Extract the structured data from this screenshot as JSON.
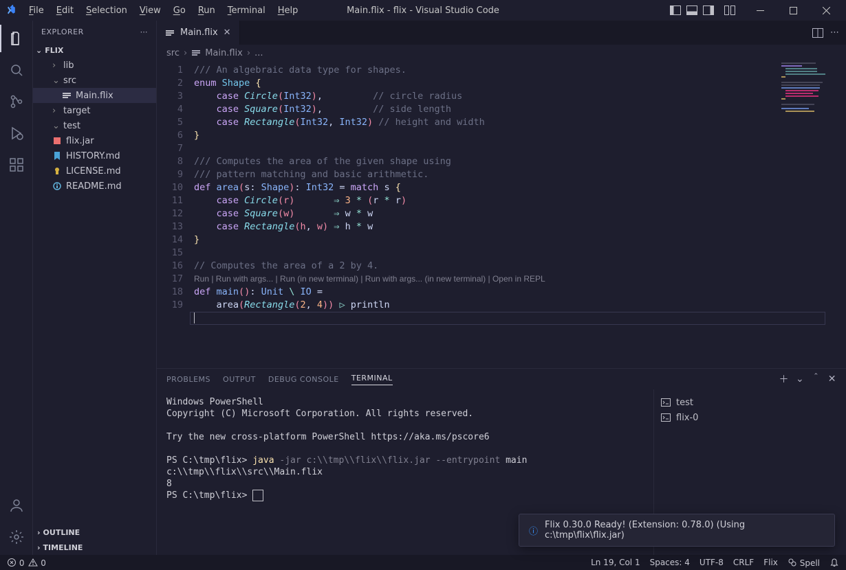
{
  "menu": [
    "File",
    "Edit",
    "Selection",
    "View",
    "Go",
    "Run",
    "Terminal",
    "Help"
  ],
  "window_title": "Main.flix - flix - Visual Studio Code",
  "sidebar": {
    "title": "EXPLORER",
    "root": "FLIX",
    "tree": {
      "lib": "lib",
      "src": "src",
      "main": "Main.flix",
      "target": "target",
      "test": "test",
      "flixjar": "flix.jar",
      "history": "HISTORY.md",
      "license": "LICENSE.md",
      "readme": "README.md"
    },
    "outline": "OUTLINE",
    "timeline": "TIMELINE"
  },
  "tab": {
    "name": "Main.flix"
  },
  "breadcrumb": {
    "a": "src",
    "b": "Main.flix",
    "c": "..."
  },
  "line_numbers": [
    "1",
    "2",
    "3",
    "4",
    "5",
    "6",
    "7",
    "8",
    "9",
    "10",
    "11",
    "12",
    "13",
    "14",
    "15",
    "16",
    "",
    "17",
    "18",
    "19"
  ],
  "codelens": "Run | Run with args... | Run (in new terminal) | Run with args... (in new terminal) | Open in REPL",
  "code": {
    "l1": "/// An algebraic data type for shapes.",
    "l2a": "enum",
    "l2b": "Shape",
    "l2c": "{",
    "l3a": "case",
    "l3b": "Circle",
    "l3c": "Int32",
    "l3d": ",",
    "l3e": "// circle radius",
    "l4a": "case",
    "l4b": "Square",
    "l4c": "Int32",
    "l4d": ",",
    "l4e": "// side length",
    "l5a": "case",
    "l5b": "Rectangle",
    "l5c": "Int32",
    "l5d": ",",
    "l5e": "Int32",
    "l5f": "// height and width",
    "l6": "}",
    "l8a": "/// Computes the area of the given shape using",
    "l9a": "/// pattern matching and basic arithmetic.",
    "l10a": "def",
    "l10b": "area",
    "l10c": "s",
    "l10d": "Shape",
    "l10e": "Int32",
    "l10f": "match",
    "l10g": "s",
    "l10h": "{",
    "l11a": "case",
    "l11b": "Circle",
    "l11c": "r",
    "l11d": "⇒",
    "l11e": "3",
    "l11f": "*",
    "l11g": "r",
    "l11h": "*",
    "l11i": "r",
    "l12a": "case",
    "l12b": "Square",
    "l12c": "w",
    "l12d": "⇒",
    "l12e": "w",
    "l12f": "*",
    "l12g": "w",
    "l13a": "case",
    "l13b": "Rectangle",
    "l13c": "h",
    "l13d": ",",
    "l13e": "w",
    "l13f": "⇒",
    "l13g": "h",
    "l13h": "*",
    "l13i": "w",
    "l14": "}",
    "l16": "// Computes the area of a 2 by 4.",
    "l17a": "def",
    "l17b": "main",
    "l17c": "Unit",
    "l17d": "\\",
    "l17e": "IO",
    "l17f": "=",
    "l18a": "area",
    "l18b": "Rectangle",
    "l18c": "2",
    "l18d": ",",
    "l18e": "4",
    "l18f": "▷",
    "l18g": "println"
  },
  "panel": {
    "tabs": [
      "PROBLEMS",
      "OUTPUT",
      "DEBUG CONSOLE",
      "TERMINAL"
    ],
    "side": [
      "test",
      "flix-0"
    ]
  },
  "terminal": {
    "l1": "Windows PowerShell",
    "l2": "Copyright (C) Microsoft Corporation. All rights reserved.",
    "l3": "Try the new cross-platform PowerShell https://aka.ms/pscore6",
    "prompt1": "PS C:\\tmp\\flix> ",
    "cmd": "java",
    "args": " -jar c:\\\\tmp\\\\flix\\\\flix.jar --entrypoint ",
    "argsmain": "main c:\\\\tmp\\\\flix\\\\src\\\\Main.flix",
    "out": "8",
    "prompt2": "PS C:\\tmp\\flix> "
  },
  "toast": "Flix 0.30.0 Ready! (Extension: 0.78.0) (Using c:\\tmp\\flix\\flix.jar)",
  "status": {
    "errors": "0",
    "warnings": "0",
    "lncol": "Ln 19, Col 1",
    "spaces": "Spaces: 4",
    "encoding": "UTF-8",
    "eol": "CRLF",
    "lang": "Flix",
    "spell": "Spell"
  }
}
